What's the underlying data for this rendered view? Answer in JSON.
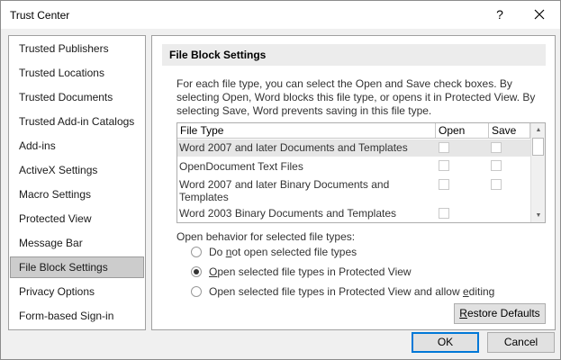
{
  "window": {
    "title": "Trust Center",
    "help_label": "?"
  },
  "sidebar": {
    "items": [
      {
        "label": "Trusted Publishers",
        "selected": false
      },
      {
        "label": "Trusted Locations",
        "selected": false
      },
      {
        "label": "Trusted Documents",
        "selected": false
      },
      {
        "label": "Trusted Add-in Catalogs",
        "selected": false
      },
      {
        "label": "Add-ins",
        "selected": false
      },
      {
        "label": "ActiveX Settings",
        "selected": false
      },
      {
        "label": "Macro Settings",
        "selected": false
      },
      {
        "label": "Protected View",
        "selected": false
      },
      {
        "label": "Message Bar",
        "selected": false
      },
      {
        "label": "File Block Settings",
        "selected": true
      },
      {
        "label": "Privacy Options",
        "selected": false
      },
      {
        "label": "Form-based Sign-in",
        "selected": false
      }
    ]
  },
  "main": {
    "section_title": "File Block Settings",
    "description": "For each file type, you can select the Open and Save check boxes. By selecting Open, Word blocks this file type, or opens it in Protected View. By selecting Save, Word prevents saving in this file type.",
    "table": {
      "columns": [
        "File Type",
        "Open",
        "Save"
      ],
      "rows": [
        {
          "file_type": "Word 2007 and later Documents and Templates",
          "open": false,
          "save": false,
          "selected": true
        },
        {
          "file_type": "OpenDocument Text Files",
          "open": false,
          "save": false,
          "selected": false
        },
        {
          "file_type": "Word 2007 and later Binary Documents and Templates",
          "open": false,
          "save": false,
          "selected": false
        },
        {
          "file_type": "Word 2003 Binary Documents and Templates",
          "open": false,
          "save": null,
          "selected": false
        }
      ]
    },
    "open_behavior": {
      "label": "Open behavior for selected file types:",
      "options": [
        {
          "pre": "Do ",
          "mnemonic": "n",
          "post": "ot open selected file types",
          "checked": false
        },
        {
          "pre": "",
          "mnemonic": "O",
          "post": "pen selected file types in Protected View",
          "checked": true
        },
        {
          "pre": "Open selected file types in Protected View and allow ",
          "mnemonic": "e",
          "post": "diting",
          "checked": false
        }
      ]
    },
    "restore_button": {
      "mnemonic": "R",
      "rest": "estore Defaults"
    }
  },
  "footer": {
    "ok_label": "OK",
    "cancel_label": "Cancel"
  }
}
